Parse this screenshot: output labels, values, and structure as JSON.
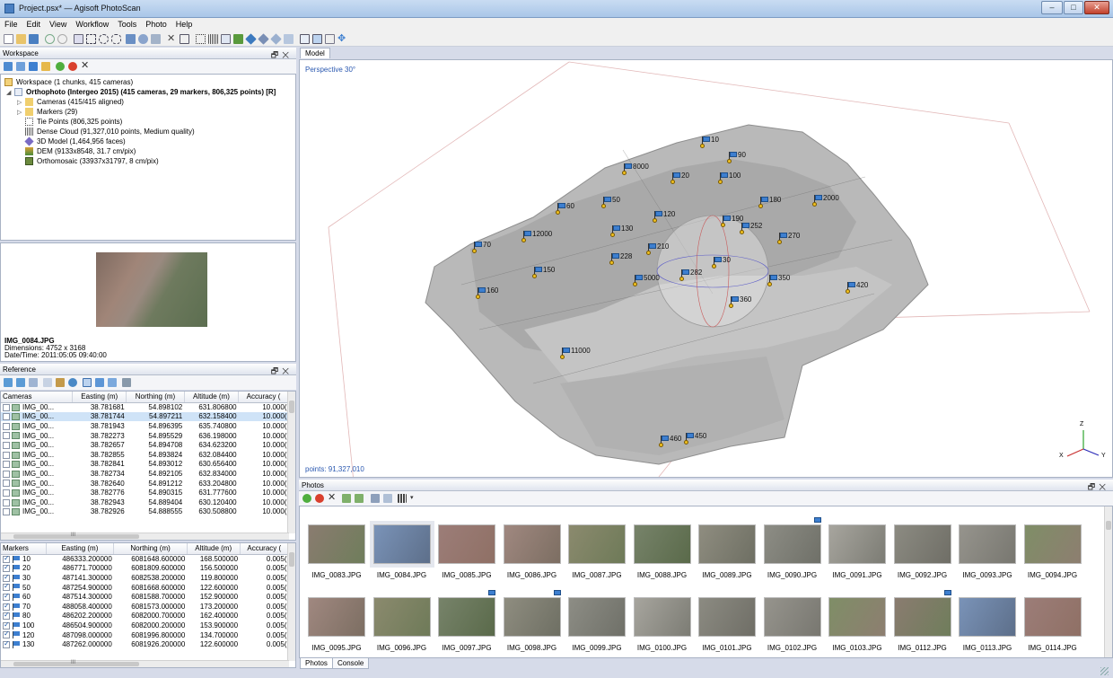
{
  "window": {
    "title": "Project.psx* — Agisoft PhotoScan"
  },
  "menu": [
    "File",
    "Edit",
    "View",
    "Workflow",
    "Tools",
    "Photo",
    "Help"
  ],
  "workspace": {
    "pane_title": "Workspace",
    "root": "Workspace (1 chunks, 415 cameras)",
    "chunk": "Orthophoto (Intergeo 2015) (415 cameras, 29 markers, 806,325 points) [R]",
    "items": [
      "Cameras (415/415 aligned)",
      "Markers (29)",
      "Tie Points (806,325 points)",
      "Dense Cloud (91,327,010 points, Medium quality)",
      "3D Model (1,464,956 faces)",
      "DEM (9133x8548, 31.7 cm/pix)",
      "Orthomosaic (33937x31797, 8 cm/pix)"
    ]
  },
  "preview": {
    "filename": "IMG_0084.JPG",
    "dimensions": "Dimensions: 4752 x 3168",
    "datetime": "Date/Time: 2011:05:05 09:40:00"
  },
  "reference": {
    "pane_title": "Reference",
    "cameras_headers": [
      "Cameras",
      "Easting (m)",
      "Northing (m)",
      "Altitude (m)",
      "Accuracy ("
    ],
    "cameras": [
      [
        "IMG_00...",
        "38.781681",
        "54.898102",
        "631.806800",
        "10.000("
      ],
      [
        "IMG_00...",
        "38.781744",
        "54.897211",
        "632.158400",
        "10.000("
      ],
      [
        "IMG_00...",
        "38.781943",
        "54.896395",
        "635.740800",
        "10.000("
      ],
      [
        "IMG_00...",
        "38.782273",
        "54.895529",
        "636.198000",
        "10.000("
      ],
      [
        "IMG_00...",
        "38.782657",
        "54.894708",
        "634.623200",
        "10.000("
      ],
      [
        "IMG_00...",
        "38.782855",
        "54.893824",
        "632.084400",
        "10.000("
      ],
      [
        "IMG_00...",
        "38.782841",
        "54.893012",
        "630.656400",
        "10.000("
      ],
      [
        "IMG_00...",
        "38.782734",
        "54.892105",
        "632.834000",
        "10.000("
      ],
      [
        "IMG_00...",
        "38.782640",
        "54.891212",
        "633.204800",
        "10.000("
      ],
      [
        "IMG_00...",
        "38.782776",
        "54.890315",
        "631.777600",
        "10.000("
      ],
      [
        "IMG_00...",
        "38.782943",
        "54.889404",
        "630.120400",
        "10.000("
      ],
      [
        "IMG_00...",
        "38.782926",
        "54.888555",
        "630.508800",
        "10.000("
      ]
    ],
    "markers_headers": [
      "Markers",
      "Easting (m)",
      "Northing (m)",
      "Altitude (m)",
      "Accuracy ("
    ],
    "markers": [
      [
        "10",
        "486333.200000",
        "6081648.600000",
        "168.500000",
        "0.005("
      ],
      [
        "20",
        "486771.700000",
        "6081809.600000",
        "156.500000",
        "0.005("
      ],
      [
        "30",
        "487141.300000",
        "6082538.200000",
        "119.800000",
        "0.005("
      ],
      [
        "50",
        "487254.900000",
        "6081668.600000",
        "122.600000",
        "0.005("
      ],
      [
        "60",
        "487514.300000",
        "6081588.700000",
        "152.900000",
        "0.005("
      ],
      [
        "70",
        "488058.400000",
        "6081573.000000",
        "173.200000",
        "0.005("
      ],
      [
        "80",
        "486202.200000",
        "6082000.700000",
        "162.400000",
        "0.005("
      ],
      [
        "100",
        "486504.900000",
        "6082000.200000",
        "153.900000",
        "0.005("
      ],
      [
        "120",
        "487098.000000",
        "6081996.800000",
        "134.700000",
        "0.005("
      ],
      [
        "130",
        "487262.000000",
        "6081926.200000",
        "122.600000",
        "0.005("
      ]
    ],
    "scroll_glyph": "III"
  },
  "model": {
    "tab": "Model",
    "perspective": "Perspective 30°",
    "points": "points: 91,327,010",
    "axes": {
      "z": "Z",
      "x": "X",
      "y": "Y"
    },
    "markers": [
      "10",
      "90",
      "8000",
      "20",
      "100",
      "180",
      "2000",
      "60",
      "50",
      "120",
      "190",
      "252",
      "270",
      "12000",
      "130",
      "70",
      "210",
      "228",
      "30",
      "150",
      "5000",
      "282",
      "350",
      "420",
      "160",
      "360",
      "11000",
      "460",
      "450"
    ]
  },
  "photos": {
    "pane_title": "Photos",
    "row1": [
      "IMG_0083.JPG",
      "IMG_0084.JPG",
      "IMG_0085.JPG",
      "IMG_0086.JPG",
      "IMG_0087.JPG",
      "IMG_0088.JPG",
      "IMG_0089.JPG",
      "IMG_0090.JPG",
      "IMG_0091.JPG",
      "IMG_0092.JPG",
      "IMG_0093.JPG",
      "IMG_0094.JPG"
    ],
    "row2": [
      "IMG_0095.JPG",
      "IMG_0096.JPG",
      "IMG_0097.JPG",
      "IMG_0098.JPG",
      "IMG_0099.JPG",
      "IMG_0100.JPG",
      "IMG_0101.JPG",
      "IMG_0102.JPG",
      "IMG_0103.JPG",
      "IMG_0112.JPG",
      "IMG_0113.JPG",
      "IMG_0114.JPG"
    ],
    "tabs": [
      "Photos",
      "Console"
    ]
  }
}
